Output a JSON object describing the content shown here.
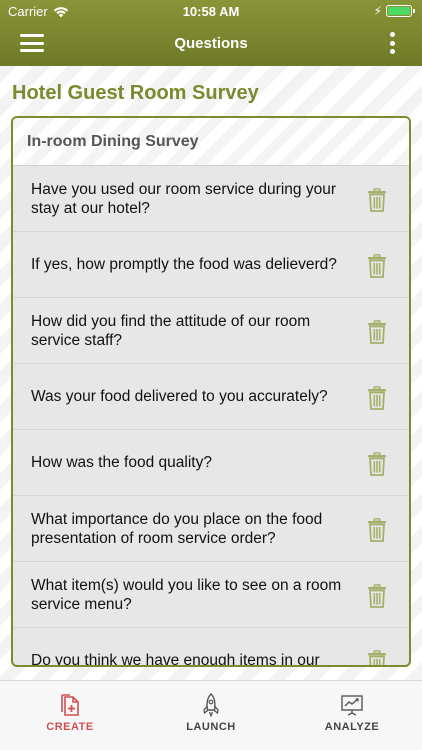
{
  "status_bar": {
    "carrier": "Carrier",
    "time": "10:58 AM"
  },
  "navbar": {
    "title": "Questions"
  },
  "survey": {
    "title": "Hotel Guest Room Survey",
    "section_title": "In-room Dining Survey",
    "questions": [
      "Have you used our room service during your stay at our hotel?",
      "If yes, how promptly the food was delieverd?",
      "How did you find the attitude of our room service staff?",
      "Was your food delivered to you accurately?",
      "How was the food quality?",
      "What importance do you place on the food presentation of room service order?",
      "What item(s) would you like to see on a room service menu?",
      "Do you think we have enough items in our"
    ]
  },
  "tabs": [
    {
      "label": "CREATE",
      "icon": "create-icon",
      "active": true
    },
    {
      "label": "LAUNCH",
      "icon": "rocket-icon",
      "active": false
    },
    {
      "label": "ANALYZE",
      "icon": "chart-icon",
      "active": false
    }
  ],
  "colors": {
    "header_green": "#7a8530",
    "title_green": "#7a8a2e",
    "trash_green": "#a7b06a",
    "active_tab_red": "#d05050"
  }
}
